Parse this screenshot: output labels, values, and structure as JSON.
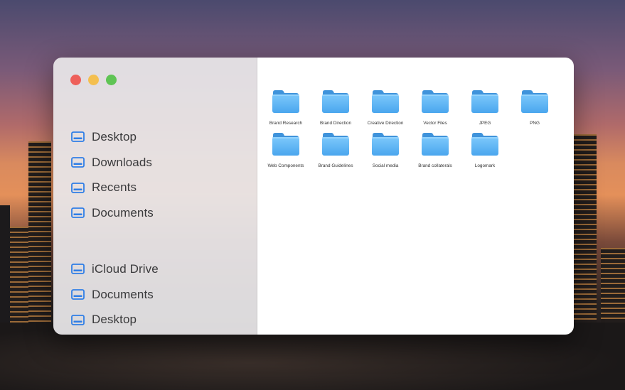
{
  "window": {
    "traffic_lights": {
      "close_color": "#ee5f5a",
      "minimize_color": "#f4bf4f",
      "zoom_color": "#5fc454"
    }
  },
  "sidebar": {
    "groups": [
      {
        "items": [
          {
            "label": "Desktop",
            "icon": "drive-icon"
          },
          {
            "label": "Downloads",
            "icon": "drive-icon"
          },
          {
            "label": "Recents",
            "icon": "drive-icon"
          },
          {
            "label": "Documents",
            "icon": "drive-icon"
          }
        ]
      },
      {
        "items": [
          {
            "label": "iCloud Drive",
            "icon": "drive-icon"
          },
          {
            "label": "Documents",
            "icon": "drive-icon"
          },
          {
            "label": "Desktop",
            "icon": "drive-icon"
          }
        ]
      }
    ],
    "accent": "#2f7ee6"
  },
  "content": {
    "folders": [
      {
        "name": "Brand Research"
      },
      {
        "name": "Brand Direction"
      },
      {
        "name": "Creative Direction"
      },
      {
        "name": "Vector Files"
      },
      {
        "name": "JPEG"
      },
      {
        "name": "PNG"
      },
      {
        "name": "Web Components"
      },
      {
        "name": "Brand Guidelines"
      },
      {
        "name": "Social media"
      },
      {
        "name": "Brand collaterals"
      },
      {
        "name": "Logomark"
      }
    ],
    "folder_color": "#5fb3f5"
  }
}
